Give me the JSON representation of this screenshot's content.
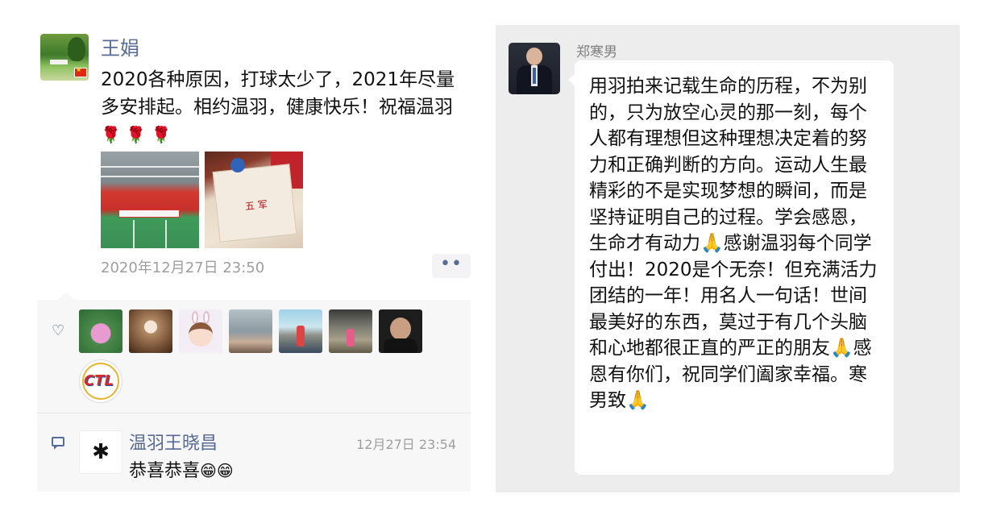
{
  "moment": {
    "poster_name": "王娟",
    "text": "2020各种原因，打球太少了，2021年尽量多安排起。相约温羽，健康快乐！祝福温羽",
    "text_emoji": "🌹 🌹 🌹",
    "timestamp": "2020年12月27日 23:50",
    "more_label": "••",
    "like_icon": "♡",
    "comment": {
      "author": "温羽王晓昌",
      "time": "12月27日 23:54",
      "text": "恭喜恭喜",
      "emoji": "😁😁"
    },
    "liker_badge_text": "CTL"
  },
  "chat": {
    "sender": "郑寒男",
    "message": "用羽拍来记载生命的历程，不为别的，只为放空心灵的那一刻，每个人都有理想但这种理想决定着的努力和正确判断的方向。运动人生最精彩的不是实现梦想的瞬间，而是坚持证明自己的过程。学会感恩，生命才有动力🙏感谢温羽每个同学付出！2020是个无奈！但充满活力团结的一年！用名人一句话！世间最美好的东西，莫过于有几个头脑和心地都很正直的严正的朋友🙏感恩有你们，祝同学们阖家幸福。寒男致🙏"
  },
  "colors": {
    "link_blue": "#576b95",
    "timestamp_gray": "#9e9e9e",
    "chat_bg": "#ededed"
  }
}
